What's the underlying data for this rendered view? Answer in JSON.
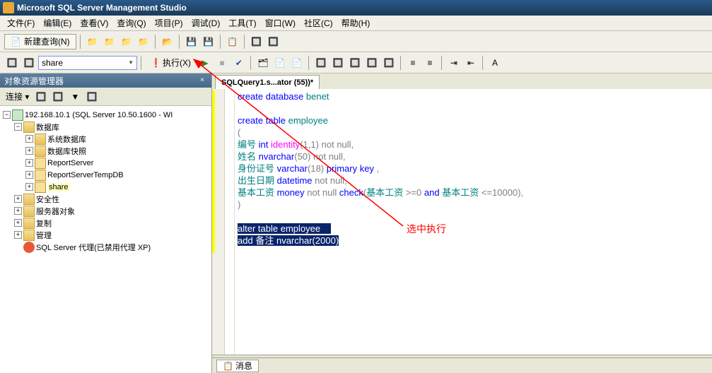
{
  "window": {
    "title": "Microsoft SQL Server Management Studio"
  },
  "menu": {
    "items": [
      "文件(F)",
      "编辑(E)",
      "查看(V)",
      "查询(Q)",
      "项目(P)",
      "调试(D)",
      "工具(T)",
      "窗口(W)",
      "社区(C)",
      "帮助(H)"
    ]
  },
  "toolbar": {
    "new_query": "新建查询(N)",
    "db_selected": "share",
    "execute": "执行(X)"
  },
  "explorer": {
    "title": "对象资源管理器",
    "connect": "连接 ▾",
    "server": "192.168.10.1 (SQL Server 10.50.1600 - WI",
    "nodes": {
      "databases": "数据库",
      "sysdb": "系统数据库",
      "snapshots": "数据库快照",
      "rs": "ReportServer",
      "rstemp": "ReportServerTempDB",
      "share": "share",
      "security": "安全性",
      "server_objects": "服务器对象",
      "replication": "复制",
      "management": "管理",
      "agent": "SQL Server 代理(已禁用代理 XP)"
    }
  },
  "tab": {
    "title": "SQLQuery1.s...ator (55))*"
  },
  "code": {
    "l1a": "create",
    "l1b": "database",
    "l1c": "benet",
    "l3a": "create",
    "l3b": "table",
    "l3c": "employee",
    "l4": "(",
    "l5a": "编号",
    "l5b": "int",
    "l5c": "identity",
    "l5d": "(",
    "l5e": "1",
    "l5f": ",",
    "l5g": "1",
    "l5h": ")",
    "l5i": "not",
    "l5j": "null",
    "l5k": ",",
    "l6a": "姓名",
    "l6b": "nvarchar",
    "l6c": "(",
    "l6d": "50",
    "l6e": ")",
    "l6f": "not",
    "l6g": "null",
    "l6h": ",",
    "l7a": "身份证号",
    "l7b": "varchar",
    "l7c": "(",
    "l7d": "18",
    "l7e": ")",
    "l7f": "primary",
    "l7g": "key",
    "l7h": ",",
    "l8a": "出生日期",
    "l8b": "datetime",
    "l8c": "not",
    "l8d": "null",
    "l8e": ",",
    "l9a": "基本工资",
    "l9b": "money",
    "l9c": "not",
    "l9d": "null",
    "l9e": "check",
    "l9f": "(",
    "l9g": "基本工资",
    "l9h": ">=",
    "l9i": "0",
    "l9j": "and",
    "l9k": "基本工资",
    "l9l": "<=",
    "l9m": "10000",
    "l9n": ")",
    "l9o": ",",
    "l10": ")",
    "l12a": "alter",
    "l12b": "table",
    "l12c": "employee",
    "l13a": "add",
    "l13b": "备注",
    "l13c": "nvarchar",
    "l13d": "(",
    "l13e": "2000",
    "l13f": ")"
  },
  "bottom": {
    "messages": "消息"
  },
  "annotation": {
    "text": "选中执行"
  }
}
